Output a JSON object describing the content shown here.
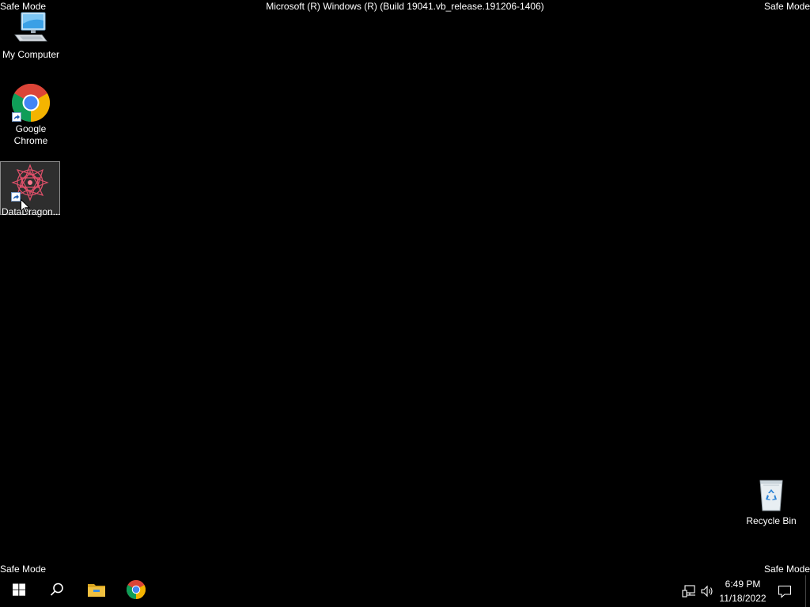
{
  "watermark": {
    "safe_mode_label": "Safe Mode",
    "build_text": "Microsoft (R) Windows (R) (Build 19041.vb_release.191206-1406)"
  },
  "desktop_icons": [
    {
      "label": "My Computer",
      "icon": "computer-icon"
    },
    {
      "label": "Google Chrome",
      "icon": "chrome-icon"
    },
    {
      "label": "DataDragon...",
      "icon": "datadragon-icon",
      "selected": true
    },
    {
      "label": "Recycle Bin",
      "icon": "recycle-bin-icon"
    }
  ],
  "taskbar": {
    "items": [
      {
        "icon": "windows-start-icon"
      },
      {
        "icon": "search-icon"
      },
      {
        "icon": "file-explorer-icon"
      },
      {
        "icon": "chrome-icon"
      }
    ],
    "clock": {
      "time": "6:49 PM",
      "date": "11/18/2022"
    },
    "tray_icons": [
      "network-icon",
      "volume-icon",
      "notifications-icon"
    ]
  },
  "colors": {
    "desktop_background": "#000000",
    "taskbar_background": "#000000",
    "chrome_red": "#db4437",
    "chrome_green": "#0f9d58",
    "chrome_yellow": "#f4b400",
    "chrome_blue": "#4285f4",
    "explorer_yellow": "#f0c040",
    "windows_blue": "#ffffff"
  }
}
